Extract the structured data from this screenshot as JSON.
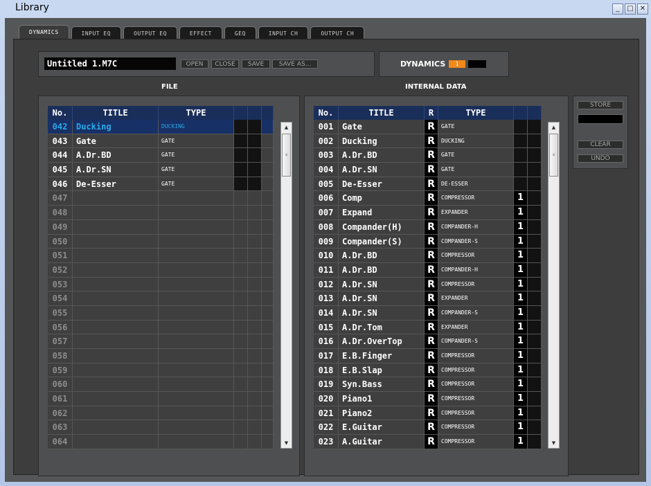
{
  "window": {
    "title": "Library"
  },
  "tabs": [
    "DYNAMICS",
    "INPUT EQ",
    "OUTPUT EQ",
    "EFFECT",
    "GEQ",
    "INPUT CH",
    "OUTPUT CH"
  ],
  "file_bar": {
    "filename": "Untitled 1.M7C",
    "open": "OPEN",
    "close": "CLOSE",
    "save": "SAVE",
    "save_as": "SAVE AS..."
  },
  "dynamics_bar": {
    "label": "DYNAMICS",
    "value": "1"
  },
  "file_section": {
    "title": "FILE",
    "headers": {
      "no": "No.",
      "title": "TITLE",
      "type": "TYPE"
    },
    "rows": [
      {
        "no": "042",
        "title": "Ducking",
        "type": "DUCKING"
      },
      {
        "no": "043",
        "title": "Gate",
        "type": "GATE"
      },
      {
        "no": "044",
        "title": "A.Dr.BD",
        "type": "GATE"
      },
      {
        "no": "045",
        "title": "A.Dr.SN",
        "type": "GATE"
      },
      {
        "no": "046",
        "title": "De-Esser",
        "type": "GATE"
      },
      {
        "no": "047",
        "title": "",
        "type": ""
      },
      {
        "no": "048",
        "title": "",
        "type": ""
      },
      {
        "no": "049",
        "title": "",
        "type": ""
      },
      {
        "no": "050",
        "title": "",
        "type": ""
      },
      {
        "no": "051",
        "title": "",
        "type": ""
      },
      {
        "no": "052",
        "title": "",
        "type": ""
      },
      {
        "no": "053",
        "title": "",
        "type": ""
      },
      {
        "no": "054",
        "title": "",
        "type": ""
      },
      {
        "no": "055",
        "title": "",
        "type": ""
      },
      {
        "no": "056",
        "title": "",
        "type": ""
      },
      {
        "no": "057",
        "title": "",
        "type": ""
      },
      {
        "no": "058",
        "title": "",
        "type": ""
      },
      {
        "no": "059",
        "title": "",
        "type": ""
      },
      {
        "no": "060",
        "title": "",
        "type": ""
      },
      {
        "no": "061",
        "title": "",
        "type": ""
      },
      {
        "no": "062",
        "title": "",
        "type": ""
      },
      {
        "no": "063",
        "title": "",
        "type": ""
      },
      {
        "no": "064",
        "title": "",
        "type": ""
      }
    ]
  },
  "internal_section": {
    "title": "INTERNAL DATA",
    "headers": {
      "no": "No.",
      "title": "TITLE",
      "r": "R",
      "type": "TYPE"
    },
    "rows": [
      {
        "no": "001",
        "title": "Gate",
        "r": "R",
        "type": "GATE",
        "ch": ""
      },
      {
        "no": "002",
        "title": "Ducking",
        "r": "R",
        "type": "DUCKING",
        "ch": ""
      },
      {
        "no": "003",
        "title": "A.Dr.BD",
        "r": "R",
        "type": "GATE",
        "ch": ""
      },
      {
        "no": "004",
        "title": "A.Dr.SN",
        "r": "R",
        "type": "GATE",
        "ch": ""
      },
      {
        "no": "005",
        "title": "De-Esser",
        "r": "R",
        "type": "DE-ESSER",
        "ch": ""
      },
      {
        "no": "006",
        "title": "Comp",
        "r": "R",
        "type": "COMPRESSOR",
        "ch": "1"
      },
      {
        "no": "007",
        "title": "Expand",
        "r": "R",
        "type": "EXPANDER",
        "ch": "1"
      },
      {
        "no": "008",
        "title": "Compander(H)",
        "r": "R",
        "type": "COMPANDER-H",
        "ch": "1"
      },
      {
        "no": "009",
        "title": "Compander(S)",
        "r": "R",
        "type": "COMPANDER-S",
        "ch": "1"
      },
      {
        "no": "010",
        "title": "A.Dr.BD",
        "r": "R",
        "type": "COMPRESSOR",
        "ch": "1"
      },
      {
        "no": "011",
        "title": "A.Dr.BD",
        "r": "R",
        "type": "COMPANDER-H",
        "ch": "1"
      },
      {
        "no": "012",
        "title": "A.Dr.SN",
        "r": "R",
        "type": "COMPRESSOR",
        "ch": "1"
      },
      {
        "no": "013",
        "title": "A.Dr.SN",
        "r": "R",
        "type": "EXPANDER",
        "ch": "1"
      },
      {
        "no": "014",
        "title": "A.Dr.SN",
        "r": "R",
        "type": "COMPANDER-S",
        "ch": "1"
      },
      {
        "no": "015",
        "title": "A.Dr.Tom",
        "r": "R",
        "type": "EXPANDER",
        "ch": "1"
      },
      {
        "no": "016",
        "title": "A.Dr.OverTop",
        "r": "R",
        "type": "COMPANDER-S",
        "ch": "1"
      },
      {
        "no": "017",
        "title": "E.B.Finger",
        "r": "R",
        "type": "COMPRESSOR",
        "ch": "1"
      },
      {
        "no": "018",
        "title": "E.B.Slap",
        "r": "R",
        "type": "COMPRESSOR",
        "ch": "1"
      },
      {
        "no": "019",
        "title": "Syn.Bass",
        "r": "R",
        "type": "COMPRESSOR",
        "ch": "1"
      },
      {
        "no": "020",
        "title": "Piano1",
        "r": "R",
        "type": "COMPRESSOR",
        "ch": "1"
      },
      {
        "no": "021",
        "title": "Piano2",
        "r": "R",
        "type": "COMPRESSOR",
        "ch": "1"
      },
      {
        "no": "022",
        "title": "E.Guitar",
        "r": "R",
        "type": "COMPRESSOR",
        "ch": "1"
      },
      {
        "no": "023",
        "title": "A.Guitar",
        "r": "R",
        "type": "COMPRESSOR",
        "ch": "1"
      }
    ]
  },
  "side_buttons": {
    "store": "STORE",
    "clear": "CLEAR",
    "undo": "UNDO"
  },
  "colors": {
    "selected_text": "#29a9e8",
    "header_bg": "#1a2e5a",
    "badge": "#f08a1c"
  }
}
